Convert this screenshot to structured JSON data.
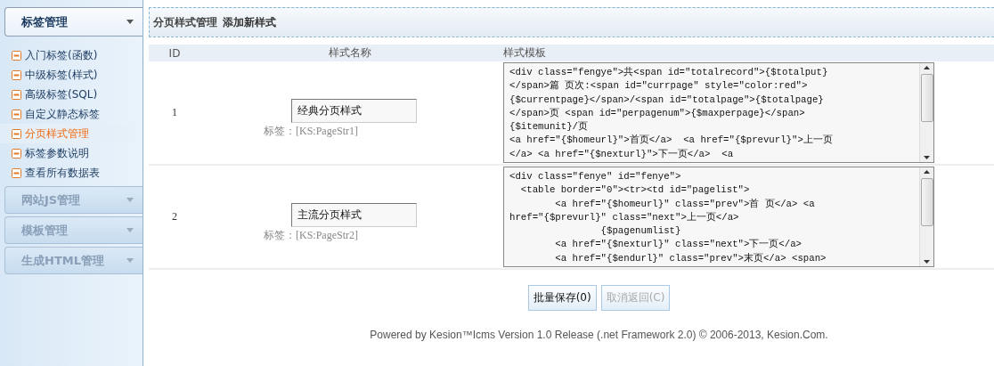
{
  "sidebar": {
    "groups": [
      {
        "title": "标签管理",
        "expanded": true,
        "items": [
          {
            "label": "入门标签(函数)",
            "selected": false
          },
          {
            "label": "中级标签(样式)",
            "selected": false
          },
          {
            "label": "高级标签(SQL)",
            "selected": false
          },
          {
            "label": "自定义静态标签",
            "selected": false
          },
          {
            "label": "分页样式管理",
            "selected": true
          },
          {
            "label": "标签参数说明",
            "selected": false
          },
          {
            "label": "查看所有数据表",
            "selected": false
          }
        ]
      },
      {
        "title": "网站JS管理",
        "expanded": false
      },
      {
        "title": "模板管理",
        "expanded": false
      },
      {
        "title": "生成HTML管理",
        "expanded": false
      }
    ]
  },
  "header": {
    "title": "分页样式管理",
    "action": "添加新样式"
  },
  "table": {
    "columns": [
      "ID",
      "样式名称",
      "样式模板"
    ],
    "rows": [
      {
        "id": "1",
        "name": "经典分页样式",
        "tag_label": "标签：",
        "tag": "[KS:PageStr1]",
        "template": "<div class=\"fengye\">共<span id=\"totalrecord\">{$totalput}\n</span>篇 页次:<span id=\"currpage\" style=\"color:red\">\n{$currentpage}</span>/<span id=\"totalpage\">{$totalpage}\n</span>页 <span id=\"perpagenum\">{$maxperpage}</span>\n{$itemunit}/页\n<a href=\"{$homeurl}\">首页</a>  <a href=\"{$prevurl}\">上一页\n</a> <a href=\"{$nexturl}\">下一页</a>  <a"
      },
      {
        "id": "2",
        "name": "主流分页样式",
        "tag_label": "标签：",
        "tag": "[KS:PageStr2]",
        "template": "<div class=\"fenye\" id=\"fenye\">\n  <table border=\"0\"><tr><td id=\"pagelist\">\n        <a href=\"{$homeurl}\" class=\"prev\">首 页</a> <a\nhref=\"{$prevurl}\" class=\"next\">上一页</a>\n                {$pagenumlist}\n        <a href=\"{$nexturl}\" class=\"next\">下一页</a>\n        <a href=\"{$endurl}\" class=\"prev\">末页</a> <span>"
      }
    ]
  },
  "buttons": [
    {
      "label": "批量保存(0)",
      "disabled": false
    },
    {
      "label": "取消返回(C)",
      "disabled": true
    }
  ],
  "footer": "Powered by Kesion™Icms Version 1.0 Release (.net Framework 2.0) © 2006-2013, Kesion.Com."
}
